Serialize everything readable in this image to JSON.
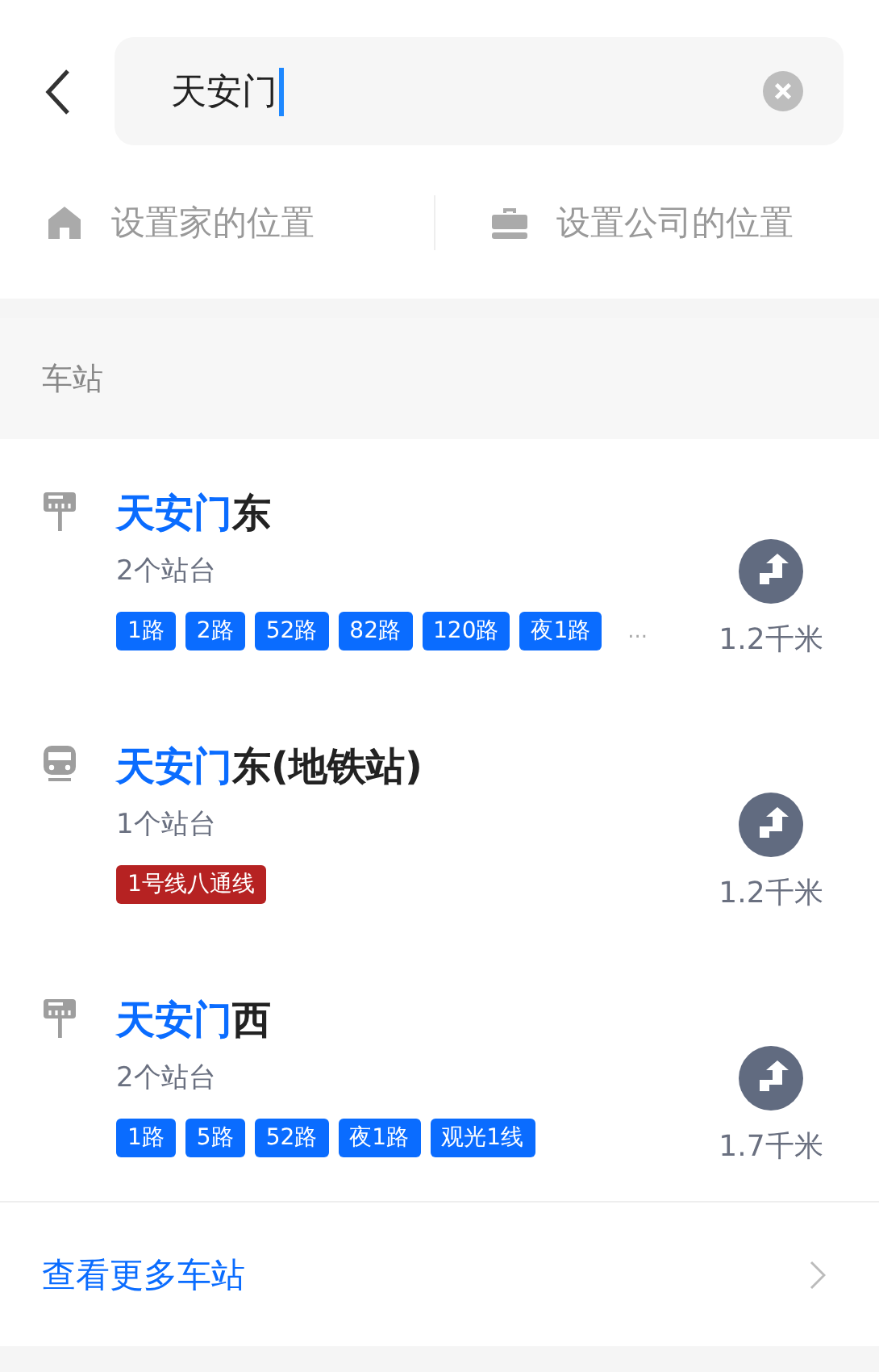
{
  "search": {
    "value": "天安门"
  },
  "shortcuts": [
    {
      "kind": "home",
      "label": "设置家的位置"
    },
    {
      "kind": "work",
      "label": "设置公司的位置"
    }
  ],
  "section": {
    "title": "车站"
  },
  "stations": [
    {
      "kind": "bus",
      "match": "天安门",
      "rest": "东",
      "platforms": "2个站台",
      "tags": [
        {
          "label": "1路",
          "color": "#0a6cff"
        },
        {
          "label": "2路",
          "color": "#0a6cff"
        },
        {
          "label": "52路",
          "color": "#0a6cff"
        },
        {
          "label": "82路",
          "color": "#0a6cff"
        },
        {
          "label": "120路",
          "color": "#0a6cff"
        },
        {
          "label": "夜1路",
          "color": "#0a6cff"
        }
      ],
      "overflow": "...",
      "distance": "1.2千米"
    },
    {
      "kind": "subway",
      "match": "天安门",
      "rest": "东(地铁站)",
      "platforms": "1个站台",
      "tags": [
        {
          "label": "1号线八通线",
          "color": "#b62222"
        }
      ],
      "distance": "1.2千米"
    },
    {
      "kind": "bus",
      "match": "天安门",
      "rest": "西",
      "platforms": "2个站台",
      "tags": [
        {
          "label": "1路",
          "color": "#0a6cff"
        },
        {
          "label": "5路",
          "color": "#0a6cff"
        },
        {
          "label": "52路",
          "color": "#0a6cff"
        },
        {
          "label": "夜1路",
          "color": "#0a6cff"
        },
        {
          "label": "观光1线",
          "color": "#0a6cff"
        }
      ],
      "distance": "1.7千米"
    }
  ],
  "more": {
    "label": "查看更多车站"
  }
}
